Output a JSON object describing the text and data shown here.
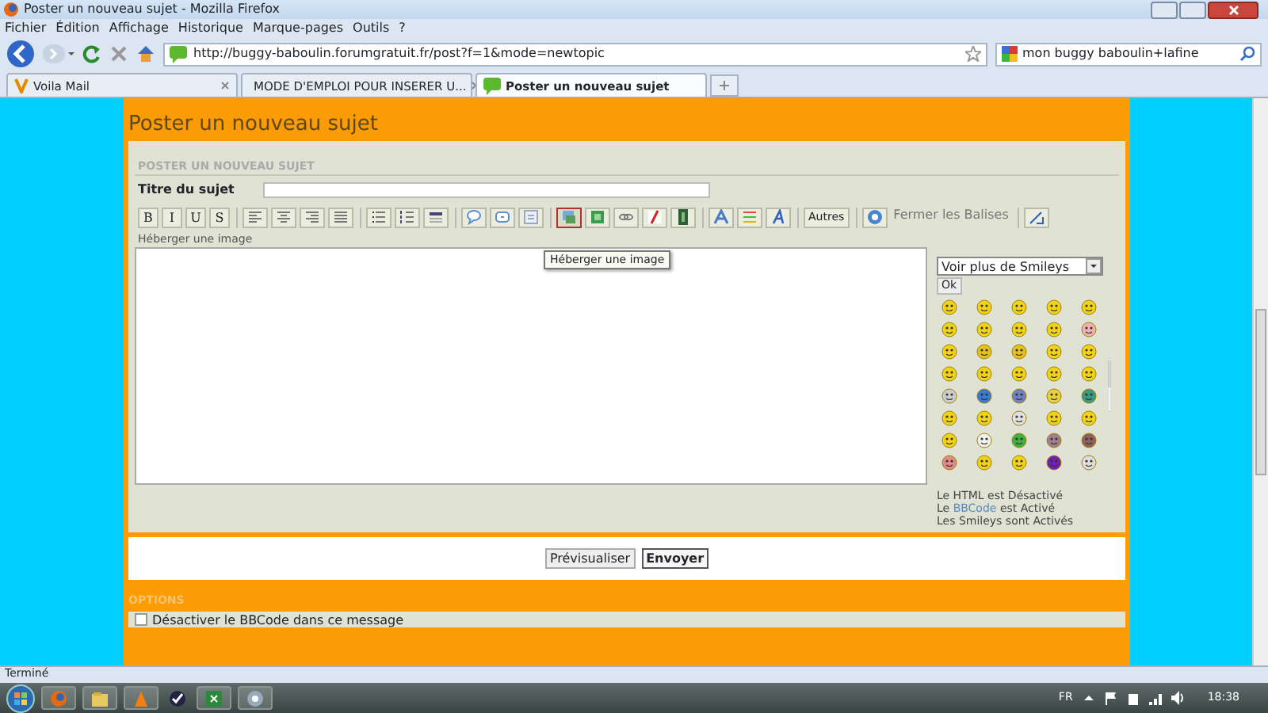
{
  "window": {
    "title": "Poster un nouveau sujet - Mozilla Firefox"
  },
  "menu": [
    "Fichier",
    "Édition",
    "Affichage",
    "Historique",
    "Marque-pages",
    "Outils",
    "?"
  ],
  "address": {
    "url": "http://buggy-baboulin.forumgratuit.fr/post?f=1&mode=newtopic"
  },
  "search": {
    "value": "mon buggy baboulin+lafine"
  },
  "tabs": [
    {
      "label": "Voila Mail",
      "selected": false
    },
    {
      "label": "MODE D'EMPLOI POUR INSERER U...",
      "selected": false
    },
    {
      "label": "Poster un nouveau sujet",
      "selected": true
    }
  ],
  "page": {
    "heading": "Poster un nouveau sujet",
    "section_title": "POSTER UN NOUVEAU SUJET",
    "subject_label": "Titre du sujet",
    "toolbar": [
      [
        {
          "kind": "letter",
          "label": "B",
          "highlighted": false
        },
        {
          "kind": "letter",
          "label": "I",
          "highlighted": false
        },
        {
          "kind": "letter",
          "label": "U",
          "highlighted": false
        },
        {
          "kind": "letter",
          "label": "S",
          "highlighted": false
        }
      ],
      [
        {
          "kind": "align-left",
          "highlighted": false
        },
        {
          "kind": "align-center",
          "highlighted": false
        },
        {
          "kind": "align-right",
          "highlighted": false
        },
        {
          "kind": "justify",
          "highlighted": false
        }
      ],
      [
        {
          "kind": "bullet-list",
          "highlighted": false
        },
        {
          "kind": "number-list",
          "highlighted": false
        },
        {
          "kind": "rule",
          "highlighted": false
        }
      ],
      [
        {
          "kind": "quote",
          "highlighted": false
        },
        {
          "kind": "code",
          "highlighted": false
        },
        {
          "kind": "spoiler",
          "highlighted": false
        }
      ],
      [
        {
          "kind": "host-image",
          "highlighted": true
        },
        {
          "kind": "image",
          "highlighted": false
        },
        {
          "kind": "link",
          "highlighted": false
        },
        {
          "kind": "flash",
          "highlighted": false
        },
        {
          "kind": "video",
          "highlighted": false
        }
      ],
      [
        {
          "kind": "color",
          "highlighted": false
        },
        {
          "kind": "highlight",
          "highlighted": false
        },
        {
          "kind": "font",
          "highlighted": false
        }
      ],
      [
        {
          "kind": "text-button",
          "label": "Autres",
          "highlighted": false
        }
      ],
      [
        {
          "kind": "help",
          "highlighted": false
        },
        {
          "kind": "text-link",
          "label": "Fermer les Balises",
          "highlighted": false
        }
      ],
      [
        {
          "kind": "resize",
          "highlighted": false
        }
      ]
    ],
    "tooltip": "Héberger une image",
    "message_label": "Héberger une image",
    "smileys": {
      "select": "Voir plus de Smileys",
      "ok": "Ok"
    },
    "status_lines": [
      {
        "text": "Le HTML est Désactivé"
      },
      {
        "prefix": "Le ",
        "link": "BBCode",
        "suffix": " est Activé"
      },
      {
        "text": "Les Smileys sont Activés"
      }
    ],
    "buttons": [
      {
        "label": "Prévisualiser",
        "primary": false
      },
      {
        "label": "Envoyer",
        "primary": true
      }
    ],
    "options": {
      "title": "OPTIONS",
      "items": [
        {
          "label": "Désactiver le BBCode dans ce message",
          "checked": false
        }
      ]
    }
  },
  "status_bar": "Terminé",
  "taskbar": {
    "language": "FR",
    "clock": "18:38"
  }
}
